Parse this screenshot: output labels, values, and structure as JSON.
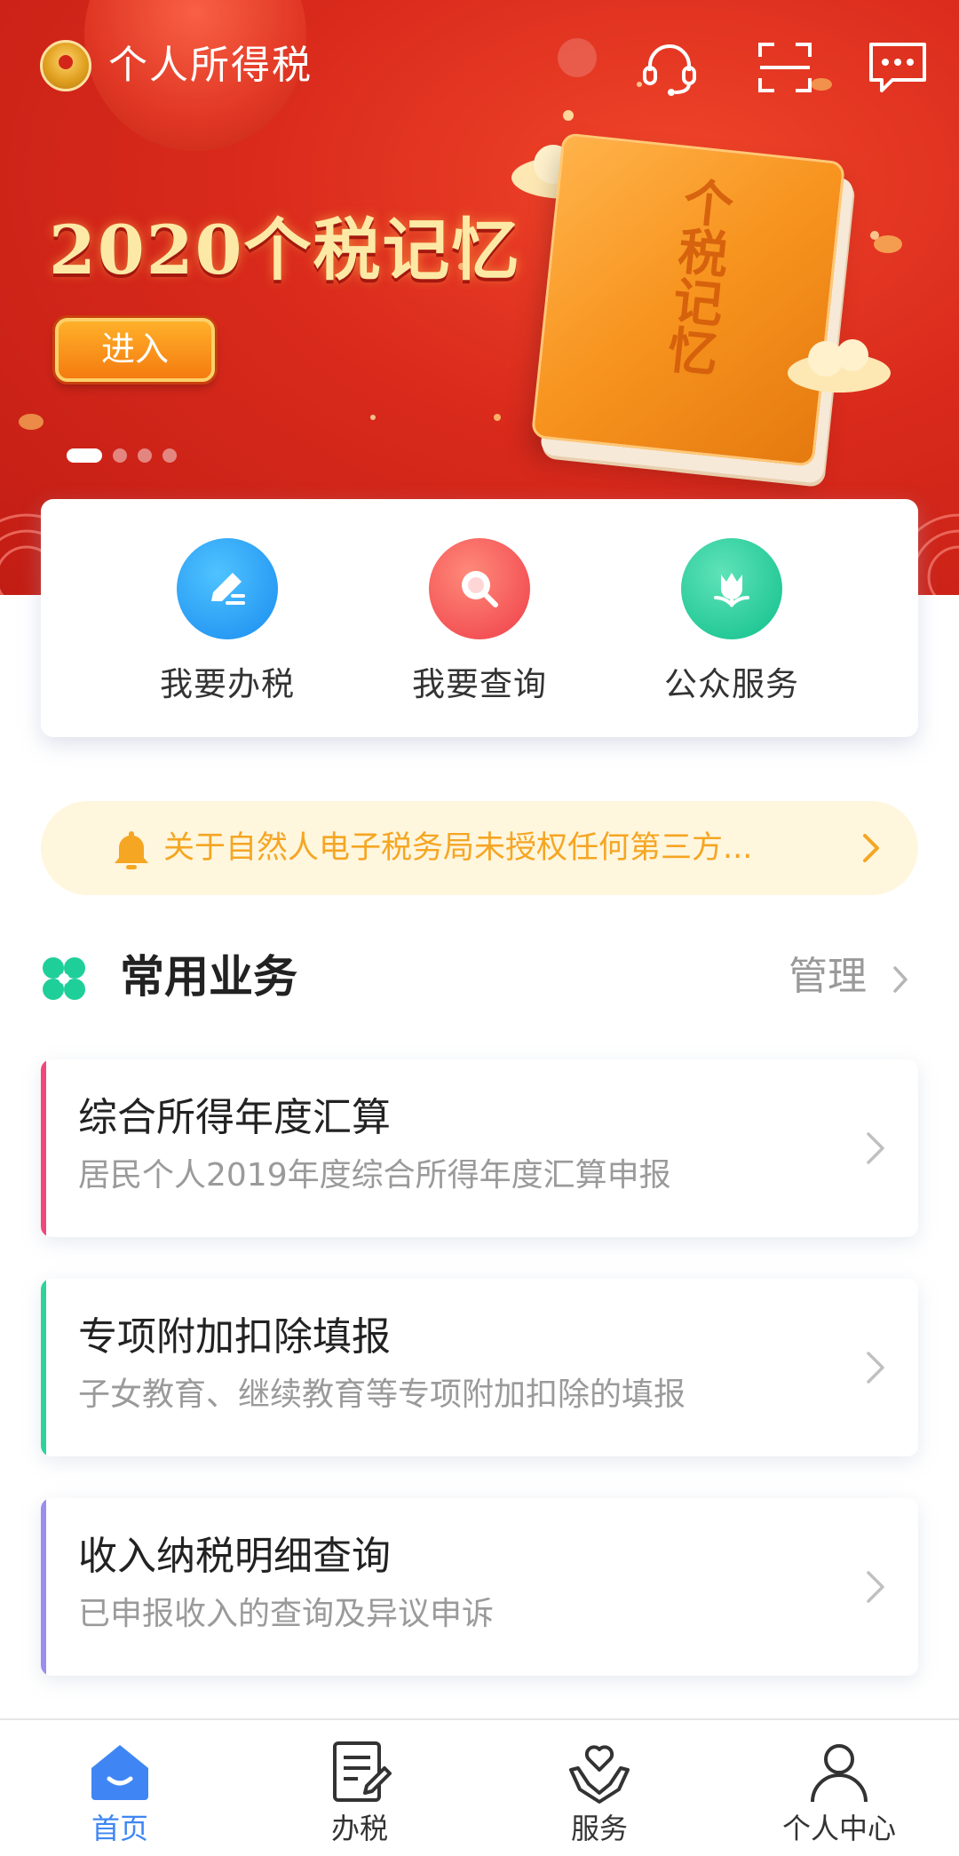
{
  "header": {
    "app_title": "个人所得税",
    "icons": [
      "headset-icon",
      "scan-icon",
      "message-icon"
    ]
  },
  "banner": {
    "heading": "2020个税记忆",
    "enter_label": "进入",
    "book_title": "个税记忆",
    "carousel_count": 4,
    "carousel_active_index": 0
  },
  "quick_actions": [
    {
      "label": "我要办税",
      "icon": "edit-icon",
      "color": "#2a9af5"
    },
    {
      "label": "我要查询",
      "icon": "search-icon",
      "color": "#f24a4a"
    },
    {
      "label": "公众服务",
      "icon": "tulip-icon",
      "color": "#1ec99a"
    }
  ],
  "notice": {
    "text": "关于自然人电子税务局未授权任何第三方...",
    "icon": "bell-icon",
    "color": "#f5a623"
  },
  "common_services": {
    "title": "常用业务",
    "manage_label": "管理",
    "items": [
      {
        "title": "综合所得年度汇算",
        "desc": "居民个人2019年度综合所得年度汇算申报",
        "accent": "#f0487a"
      },
      {
        "title": "专项附加扣除填报",
        "desc": "子女教育、继续教育等专项附加扣除的填报",
        "accent": "#2ed39a"
      },
      {
        "title": "收入纳税明细查询",
        "desc": "已申报收入的查询及异议申诉",
        "accent": "#9b8cf0"
      }
    ]
  },
  "bottom_nav": {
    "items": [
      {
        "label": "首页",
        "icon": "home-icon",
        "active": true
      },
      {
        "label": "办税",
        "icon": "document-edit-icon",
        "active": false
      },
      {
        "label": "服务",
        "icon": "heart-hands-icon",
        "active": false
      },
      {
        "label": "个人中心",
        "icon": "user-icon",
        "active": false
      }
    ],
    "active_color": "#3f86f4"
  }
}
